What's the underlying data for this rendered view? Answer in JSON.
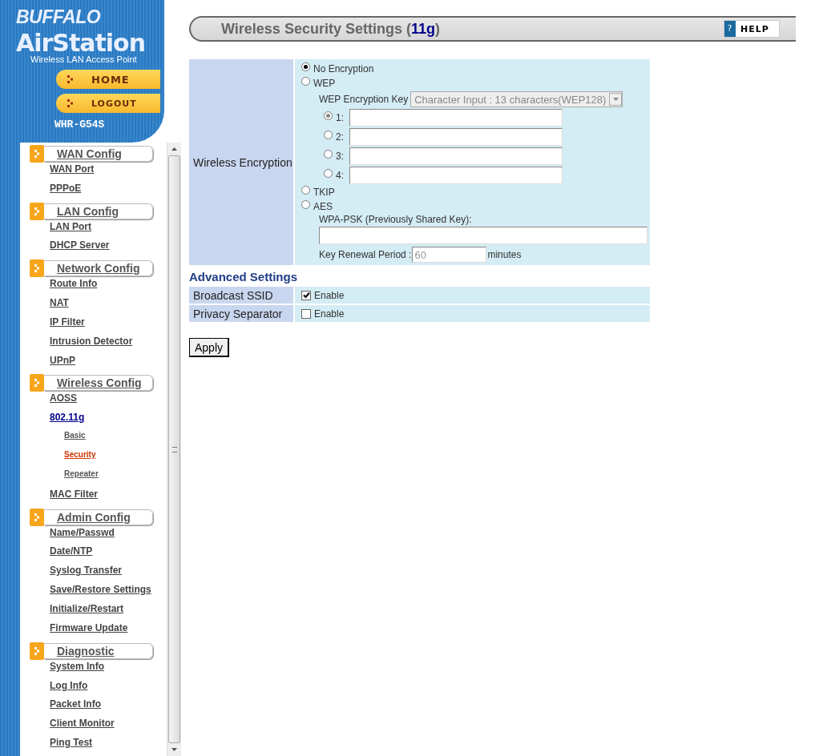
{
  "logo": {
    "brand": "BUFFALO",
    "product": "AirStation",
    "tagline": "Wireless LAN Access Point",
    "model": "WHR-G54S"
  },
  "top_buttons": [
    {
      "label": "HOME"
    },
    {
      "label": "LOGOUT"
    }
  ],
  "sidebar": {
    "sections": [
      {
        "title": "WAN Config",
        "items": [
          {
            "label": "WAN Port",
            "selected": false,
            "expanded": false
          },
          {
            "label": "PPPoE",
            "selected": false,
            "expanded": false
          }
        ]
      },
      {
        "title": "LAN Config",
        "items": [
          {
            "label": "LAN Port",
            "selected": false,
            "expanded": false
          },
          {
            "label": "DHCP Server",
            "selected": false,
            "expanded": false
          }
        ]
      },
      {
        "title": "Network Config",
        "items": [
          {
            "label": "Route Info",
            "selected": false,
            "expanded": false
          },
          {
            "label": "NAT",
            "selected": false,
            "expanded": false
          },
          {
            "label": "IP Filter",
            "selected": false,
            "expanded": false
          },
          {
            "label": "Intrusion Detector",
            "selected": false,
            "expanded": false
          },
          {
            "label": "UPnP",
            "selected": false,
            "expanded": false
          }
        ]
      },
      {
        "title": "Wireless Config",
        "items": [
          {
            "label": "AOSS",
            "selected": false,
            "expanded": false
          },
          {
            "label": "802.11g",
            "selected": false,
            "expanded": true,
            "children": [
              {
                "label": "Basic",
                "selected": false
              },
              {
                "label": "Security",
                "selected": true
              },
              {
                "label": "Repeater",
                "selected": false
              }
            ]
          },
          {
            "label": "MAC Filter",
            "selected": false,
            "expanded": false
          }
        ]
      },
      {
        "title": "Admin Config",
        "items": [
          {
            "label": "Name/Passwd",
            "selected": false,
            "expanded": false
          },
          {
            "label": "Date/NTP",
            "selected": false,
            "expanded": false
          },
          {
            "label": "Syslog Transfer",
            "selected": false,
            "expanded": false
          },
          {
            "label": "Save/Restore Settings",
            "selected": false,
            "expanded": false
          },
          {
            "label": "Initialize/Restart",
            "selected": false,
            "expanded": false
          },
          {
            "label": "Firmware Update",
            "selected": false,
            "expanded": false
          }
        ]
      },
      {
        "title": "Diagnostic",
        "items": [
          {
            "label": "System Info",
            "selected": false,
            "expanded": false
          },
          {
            "label": "Log Info",
            "selected": false,
            "expanded": false
          },
          {
            "label": "Packet Info",
            "selected": false,
            "expanded": false
          },
          {
            "label": "Client Monitor",
            "selected": false,
            "expanded": false
          },
          {
            "label": "Ping Test",
            "selected": false,
            "expanded": false
          }
        ]
      }
    ]
  },
  "title": {
    "text": "Wireless Security Settings (",
    "highlight": "11g",
    "tail": ")"
  },
  "help": {
    "icon": "?",
    "label": "HELP"
  },
  "encryption": {
    "label": "Wireless Encryption",
    "options": [
      {
        "label": "No Encryption",
        "selected": true
      },
      {
        "label": "WEP",
        "selected": false
      },
      {
        "label": "TKIP",
        "selected": false
      },
      {
        "label": "AES",
        "selected": false
      }
    ],
    "wep": {
      "key_label": "WEP Encryption Key",
      "key_format": "Character Input : 13 characters(WEP128)",
      "keys": [
        {
          "label": "1:",
          "selected": true
        },
        {
          "label": "2:",
          "selected": false
        },
        {
          "label": "3:",
          "selected": false
        },
        {
          "label": "4:",
          "selected": false
        }
      ]
    },
    "wpa": {
      "psk_label": "WPA-PSK (Previously Shared Key):",
      "renewal_label": "Key Renewal Period :",
      "renewal_value": "60",
      "renewal_unit": "minutes"
    }
  },
  "advanced": {
    "heading": "Advanced Settings",
    "rows": [
      {
        "label": "Broadcast SSID",
        "option": "Enable",
        "checked": true
      },
      {
        "label": "Privacy Separator",
        "option": "Enable",
        "checked": false
      }
    ]
  },
  "apply": "Apply"
}
